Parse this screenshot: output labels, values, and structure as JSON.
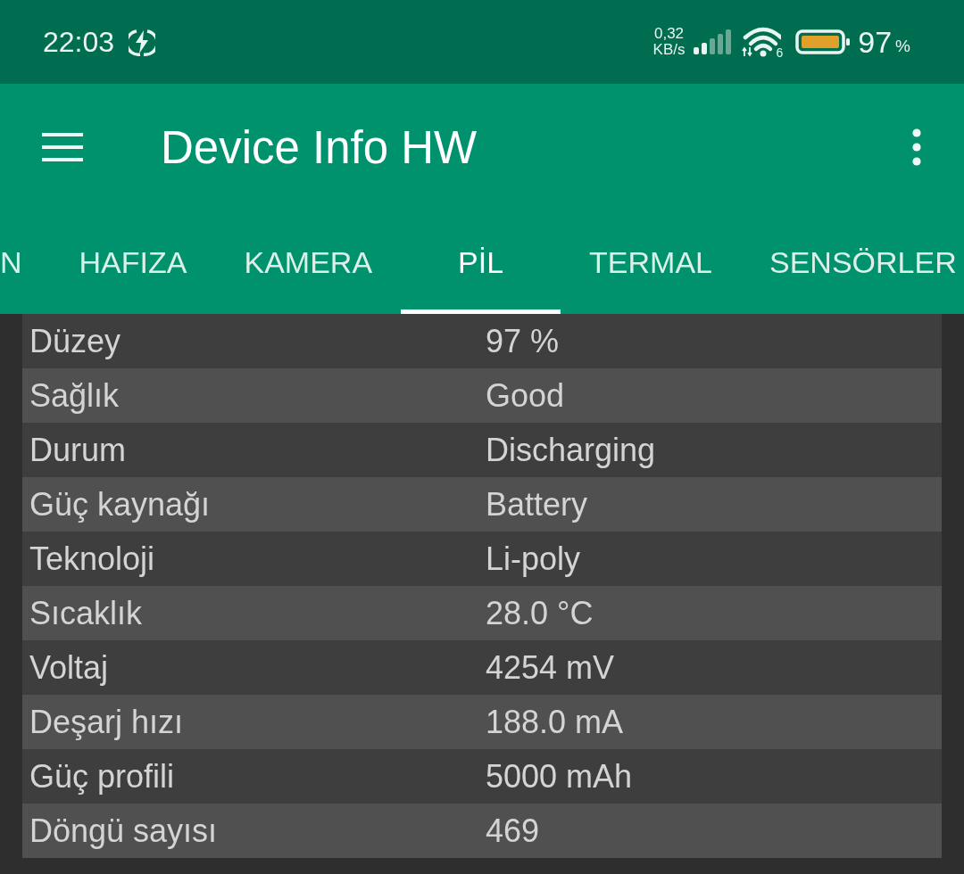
{
  "status_bar": {
    "time": "22:03",
    "net_speed": {
      "value": "0,32",
      "unit": "KB/s"
    },
    "wifi_badge": "6",
    "battery": {
      "value": "97",
      "unit": "%"
    }
  },
  "app_bar": {
    "title": "Device Info HW"
  },
  "tabs": [
    {
      "label": "N",
      "selected": false
    },
    {
      "label": "HAFIZA",
      "selected": false
    },
    {
      "label": "KAMERA",
      "selected": false
    },
    {
      "label": "PİL",
      "selected": true
    },
    {
      "label": "TERMAL",
      "selected": false
    },
    {
      "label": "SENSÖRLER",
      "selected": false
    }
  ],
  "rows": [
    {
      "label": "Düzey",
      "value": "97 %"
    },
    {
      "label": "Sağlık",
      "value": "Good"
    },
    {
      "label": "Durum",
      "value": "Discharging"
    },
    {
      "label": "Güç kaynağı",
      "value": "Battery"
    },
    {
      "label": "Teknoloji",
      "value": "Li-poly"
    },
    {
      "label": "Sıcaklık",
      "value": "28.0 °C"
    },
    {
      "label": "Voltaj",
      "value": "4254 mV"
    },
    {
      "label": "Deşarj hızı",
      "value": "188.0 mA"
    },
    {
      "label": "Güç profili",
      "value": "5000 mAh"
    },
    {
      "label": "Döngü sayısı",
      "value": "469"
    }
  ]
}
